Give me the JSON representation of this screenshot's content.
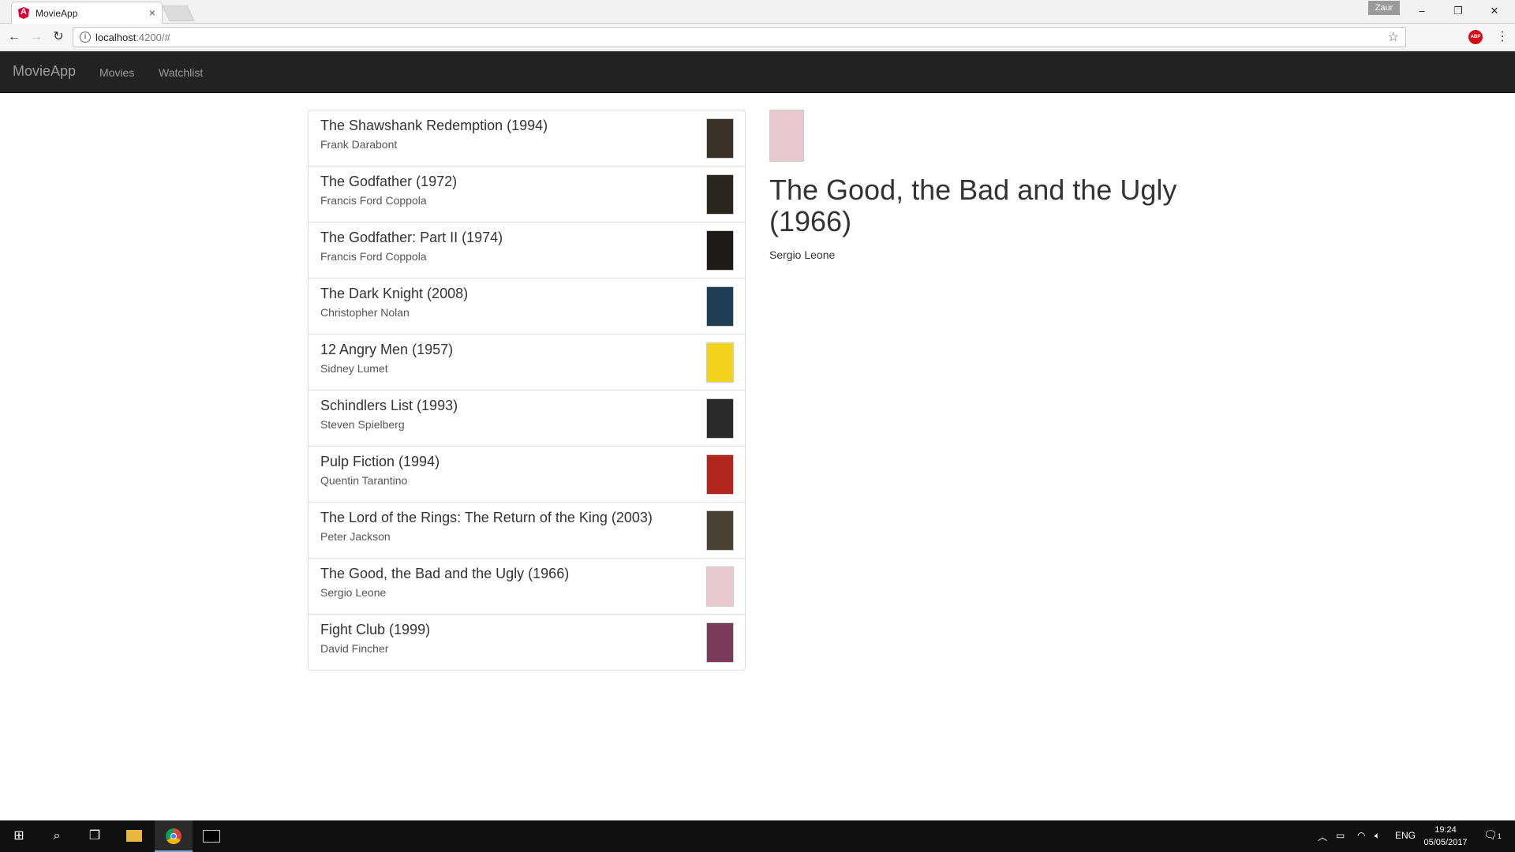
{
  "browser": {
    "tab_title": "MovieApp",
    "tab_close": "×",
    "profile_name": "Zaur",
    "url_host": "localhost",
    "url_rest": ":4200/#",
    "controls": {
      "minimize": "–",
      "restore": "❐",
      "close": "✕"
    }
  },
  "navbar": {
    "brand": "MovieApp",
    "links": [
      "Movies",
      "Watchlist"
    ]
  },
  "movies": [
    {
      "title": "The Shawshank Redemption (1994)",
      "director": "Frank Darabont",
      "poster_color": "#3a3128"
    },
    {
      "title": "The Godfather (1972)",
      "director": "Francis Ford Coppola",
      "poster_color": "#2b2520"
    },
    {
      "title": "The Godfather: Part II (1974)",
      "director": "Francis Ford Coppola",
      "poster_color": "#1e1a18"
    },
    {
      "title": "The Dark Knight (2008)",
      "director": "Christopher Nolan",
      "poster_color": "#1f3d55"
    },
    {
      "title": "12 Angry Men (1957)",
      "director": "Sidney Lumet",
      "poster_color": "#f2d21a"
    },
    {
      "title": "Schindlers List (1993)",
      "director": "Steven Spielberg",
      "poster_color": "#2a2a2a"
    },
    {
      "title": "Pulp Fiction (1994)",
      "director": "Quentin Tarantino",
      "poster_color": "#b3261e"
    },
    {
      "title": "The Lord of the Rings: The Return of the King (2003)",
      "director": "Peter Jackson",
      "poster_color": "#4a4232"
    },
    {
      "title": "The Good, the Bad and the Ugly (1966)",
      "director": "Sergio Leone",
      "poster_color": "#e8c8cf"
    },
    {
      "title": "Fight Club (1999)",
      "director": "David Fincher",
      "poster_color": "#7a3a5a"
    }
  ],
  "detail": {
    "title": "The Good, the Bad and the Ugly (1966)",
    "director": "Sergio Leone",
    "poster_color": "#e8c8cf"
  },
  "taskbar": {
    "language": "ENG",
    "time": "19:24",
    "date": "05/05/2017",
    "notifications": "1"
  }
}
